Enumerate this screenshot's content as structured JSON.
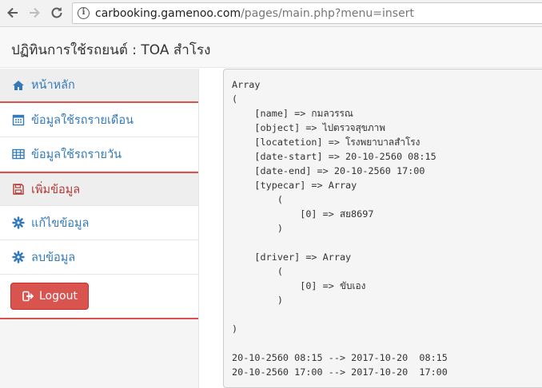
{
  "browser": {
    "url_host": "carbooking.gamenoo.com",
    "url_path": "/pages/main.php?menu=insert"
  },
  "header": {
    "title": "ปฏิทินการใช้รถยนต์ : TOA สำโรง"
  },
  "sidebar": {
    "items": [
      {
        "label": "หน้าหลัก",
        "icon": "home-icon"
      },
      {
        "label": "ข้อมูลใช้รถรายเดือน",
        "icon": "calendar-icon"
      },
      {
        "label": "ข้อมูลใช้รถรายวัน",
        "icon": "table-icon"
      },
      {
        "label": "เพิ่มข้อมูล",
        "icon": "save-icon"
      },
      {
        "label": "แก้ไขข้อมูล",
        "icon": "gear-icon"
      },
      {
        "label": "ลบข้อมูล",
        "icon": "gear-icon"
      }
    ],
    "logout_label": "Logout"
  },
  "output": {
    "text": "Array\n(\n    [name] => กมลวรรณ\n    [object] => ไปตรวจสุขภาพ\n    [locatetion] => โรงพยาบาลสำโรง\n    [date-start] => 20-10-2560 08:15\n    [date-end] => 20-10-2560 17:00\n    [typecar] => Array\n        (\n            [0] => สย8697\n        )\n\n    [driver] => Array\n        (\n            [0] => ขับเอง\n        )\n\n)\n\n20-10-2560 08:15 --> 2017-10-20  08:15\n20-10-2560 17:00 --> 2017-10-20  17:00"
  },
  "colors": {
    "accent_red": "#d9534f",
    "link_blue": "#337ab7",
    "active_red_text": "#b03a35"
  }
}
